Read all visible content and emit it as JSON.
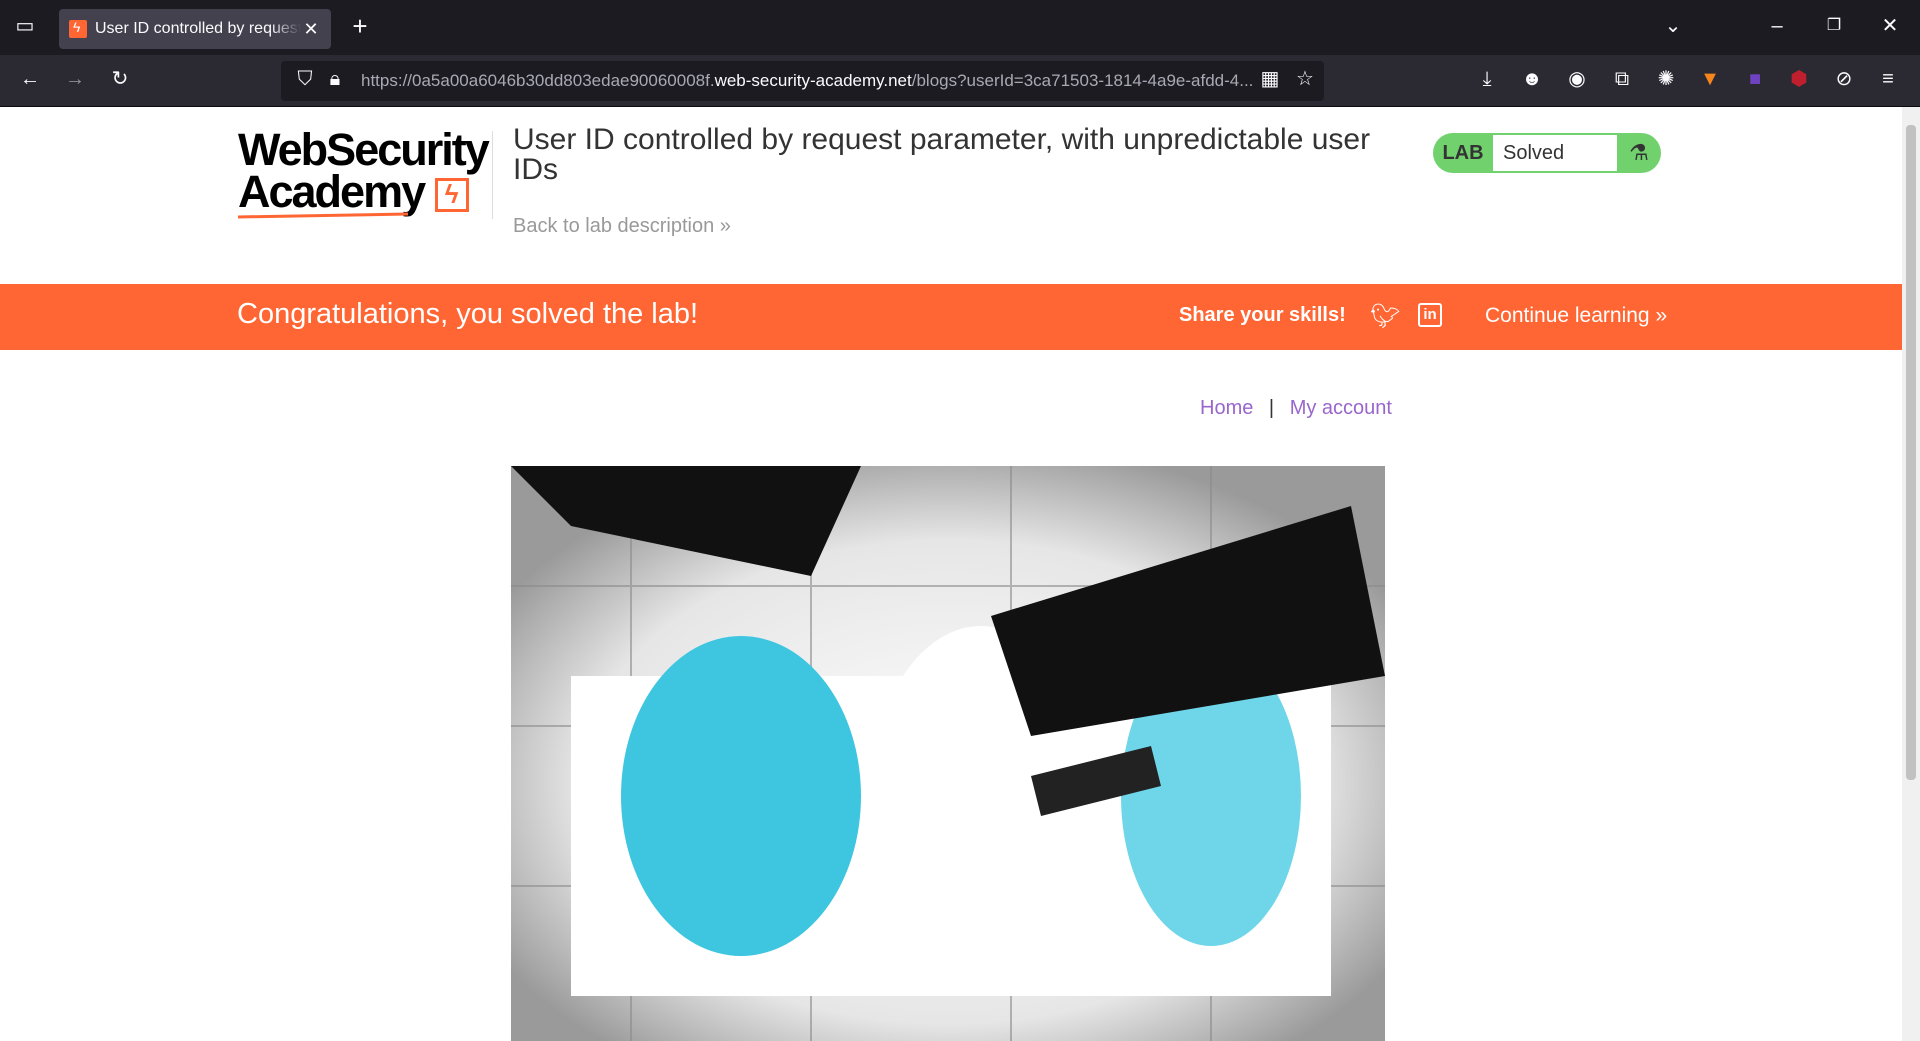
{
  "browser": {
    "tab_title": "User ID controlled by request parameter, with unpredictable user IDs",
    "url_prefix": "https://0a5a00a6046b30dd803edae90060008f.",
    "url_domain": "web-security-academy.net",
    "url_path": "/blogs?userId=3ca71503-1814-4a9e-afdd-4..."
  },
  "header": {
    "logo_line1": "WebSecurity",
    "logo_line2": "Academy",
    "title": "User ID controlled by request parameter, with unpredictable user IDs",
    "back_link": "Back to lab description",
    "lab_label": "LAB",
    "status": "Solved"
  },
  "banner": {
    "message": "Congratulations, you solved the lab!",
    "share": "Share your skills!",
    "continue": "Continue learning"
  },
  "nav": {
    "home": "Home",
    "separator": "|",
    "account": "My account"
  }
}
